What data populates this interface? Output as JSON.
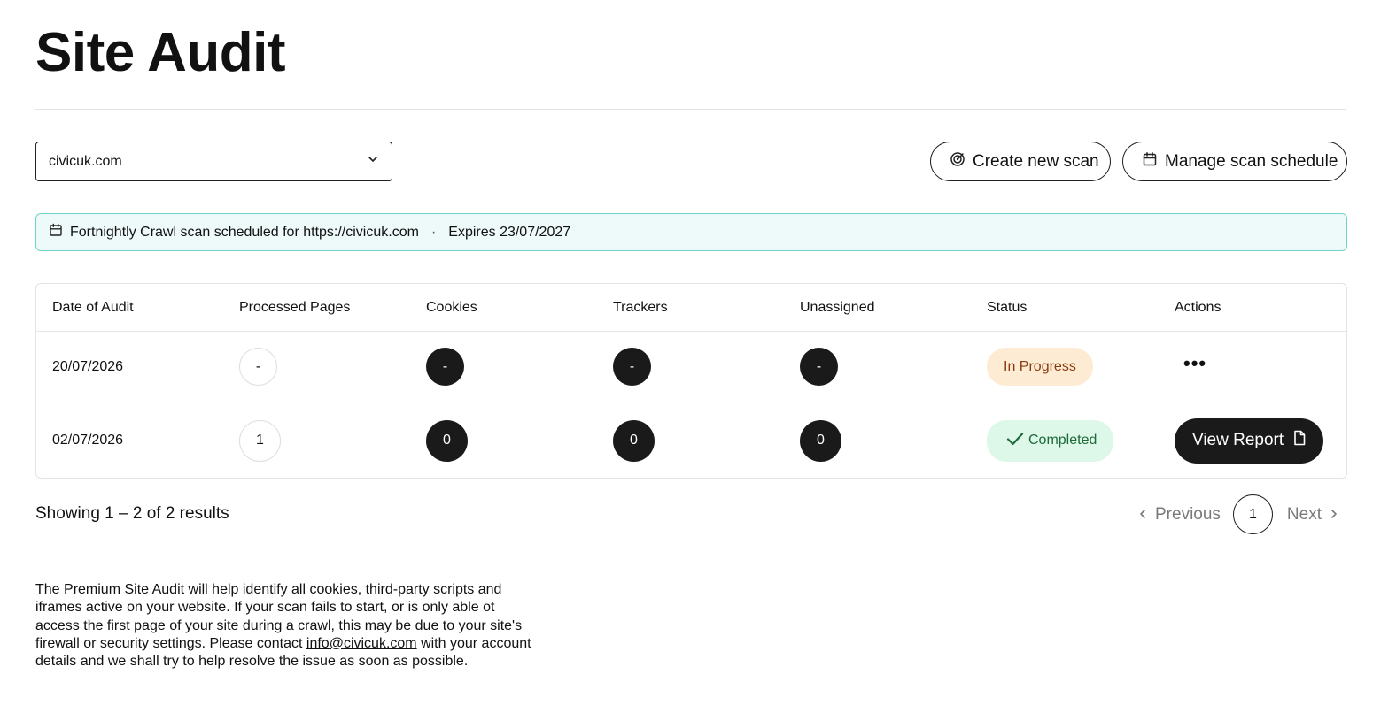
{
  "page": {
    "title": "Site Audit"
  },
  "toolbar": {
    "site_select_value": "civicuk.com",
    "create_scan_label": "Create new scan",
    "manage_schedule_label": "Manage scan schedule"
  },
  "banner": {
    "schedule_text": "Fortnightly Crawl scan scheduled for https://civicuk.com",
    "separator": "·",
    "expires_text": "Expires 23/07/2027"
  },
  "table": {
    "headers": [
      "Date of Audit",
      "Processed Pages",
      "Cookies",
      "Trackers",
      "Unassigned",
      "Status",
      "Actions"
    ],
    "rows": [
      {
        "date": "20/07/2026",
        "processed": "-",
        "cookies": "-",
        "trackers": "-",
        "unassigned": "-",
        "status": "In Progress",
        "actions": "•••"
      },
      {
        "date": "02/07/2026",
        "processed": "1",
        "cookies": "0",
        "trackers": "0",
        "unassigned": "0",
        "status": "Completed",
        "actions": "View Report"
      }
    ]
  },
  "results": {
    "showing_text": "Showing 1 – 2 of 2 results"
  },
  "pagination": {
    "previous_label": "Previous",
    "current_page": "1",
    "next_label": "Next"
  },
  "info": {
    "text_before": "The Premium Site Audit will help identify all cookies, third-party scripts and iframes active on your website. If your scan fails to start, or is only able ot access the first page of your site during a crawl, this may be due to your site's firewall or security settings. Please contact ",
    "email": "info@civicuk.com",
    "text_after": " with your account details and we shall try to help resolve the issue as soon as possible."
  },
  "colors": {
    "banner_bg": "#eefaf9",
    "banner_border": "#6fd3c7",
    "in_progress_bg": "#fdebd3",
    "in_progress_text": "#8a3b12",
    "completed_bg": "#ddf8e8",
    "completed_text": "#1f6a3b",
    "dark": "#1a1a1a"
  }
}
